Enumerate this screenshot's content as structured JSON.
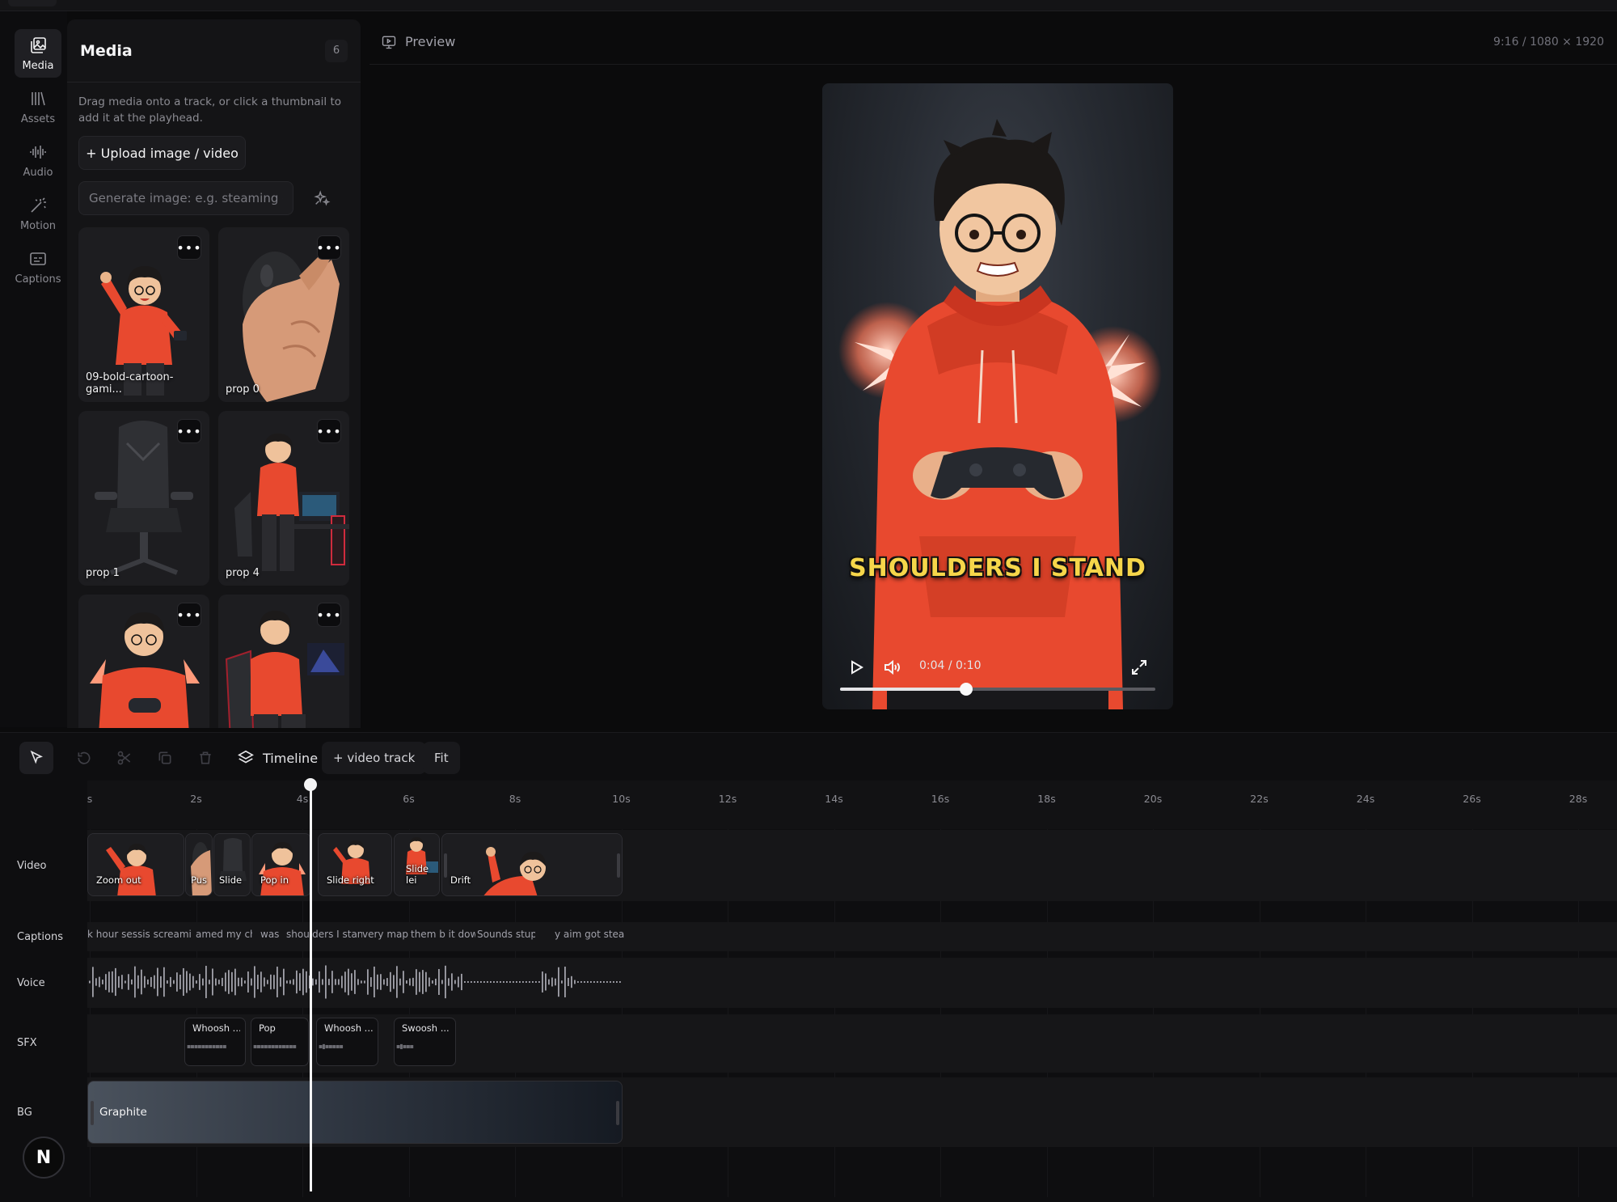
{
  "rail": {
    "items": [
      {
        "label": "Media",
        "icon": "media-icon"
      },
      {
        "label": "Assets",
        "icon": "library-icon"
      },
      {
        "label": "Audio",
        "icon": "waveform-icon"
      },
      {
        "label": "Motion",
        "icon": "magic-wand-icon"
      },
      {
        "label": "Captions",
        "icon": "captions-icon"
      }
    ]
  },
  "media": {
    "title": "Media",
    "count": "6",
    "hint": "Drag media onto a track, or click a thumbnail to add it at the playhead.",
    "upload_label": "+ Upload image / video",
    "generate_placeholder": "Generate image: e.g. steaming cup of",
    "items": [
      {
        "label": "09-bold-cartoon-gami..."
      },
      {
        "label": "prop 0"
      },
      {
        "label": "prop 1"
      },
      {
        "label": "prop 4"
      },
      {
        "label": ""
      },
      {
        "label": ""
      }
    ]
  },
  "preview": {
    "title": "Preview",
    "format": "9:16 / 1080 × 1920",
    "caption": "SHOULDERS I STAND",
    "time": "0:04 / 0:10",
    "progress": 0.4
  },
  "toolbar": {
    "timeline_label": "Timeline",
    "add_track_label": "+ video track",
    "fit_label": "Fit"
  },
  "timeline": {
    "ruler": [
      "s",
      "2s",
      "4s",
      "6s",
      "8s",
      "10s",
      "12s",
      "14s",
      "16s",
      "18s",
      "20s",
      "22s",
      "24s",
      "26s",
      "28s"
    ],
    "playhead_time": "0:04",
    "tracks": {
      "video": {
        "label": "Video",
        "clips": [
          "Zoom out",
          "Pus",
          "Slide",
          "Pop in",
          "Slide right",
          "Slide lei",
          "Drift"
        ]
      },
      "captions": {
        "label": "Captions",
        "segments": [
          "k hour sessis screaming",
          "amed my cha",
          "was r",
          "shoulders I stand",
          "very map i",
          "them b it down",
          "Sounds stupi",
          "y aim got steadi"
        ]
      },
      "voice": {
        "label": "Voice"
      },
      "sfx": {
        "label": "SFX",
        "clips": [
          "Whoosh ...",
          "Pop",
          "Whoosh ...",
          "Swoosh ..."
        ]
      },
      "bg": {
        "label": "BG",
        "clip": "Graphite"
      }
    }
  },
  "badge": "N",
  "colors": {
    "background": "#0b0b0c",
    "panel": "#141416",
    "caption_yellow": "#f6d64a",
    "hoodie_red": "#e8492f"
  }
}
